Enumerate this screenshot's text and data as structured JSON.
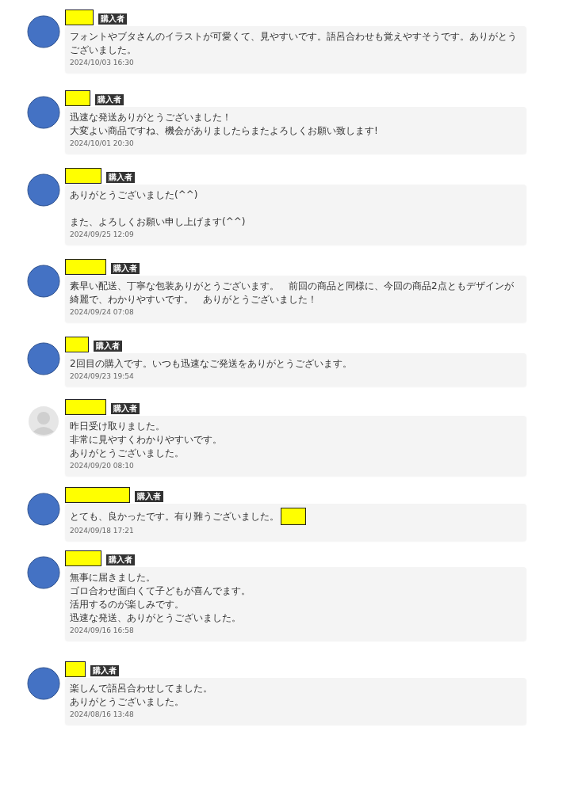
{
  "reviews": [
    {
      "avatar": {
        "kind": "circle"
      },
      "badge": "購入者",
      "paragraphs": [
        [
          "フォントやブタさんのイラストが可愛くて、見やすいです。語呂合わせも覚えやすそうです。ありがとうございました。"
        ]
      ],
      "date": "2024/10/03 16:30",
      "trailing_redaction": false
    },
    {
      "avatar": {
        "kind": "circle"
      },
      "badge": "購入者",
      "paragraphs": [
        [
          "迅速な発送ありがとうございました！",
          "大変よい商品ですね、機会がありましたらまたよろしくお願い致します!"
        ]
      ],
      "date": "2024/10/01 20:30",
      "trailing_redaction": false
    },
    {
      "avatar": {
        "kind": "circle"
      },
      "badge": "購入者",
      "paragraphs": [
        [
          "ありがとうございました(^^)"
        ],
        [
          "また、よろしくお願い申し上げます(^^)"
        ]
      ],
      "date": "2024/09/25 12:09",
      "trailing_redaction": false
    },
    {
      "avatar": {
        "kind": "circle"
      },
      "badge": "購入者",
      "paragraphs": [
        [
          "素早い配送、丁寧な包装ありがとうございます。　前回の商品と同様に、今回の商品2点ともデザインが綺麗で、わかりやすいです。　ありがとうございました！"
        ]
      ],
      "date": "2024/09/24 07:08",
      "trailing_redaction": false
    },
    {
      "avatar": {
        "kind": "circle"
      },
      "badge": "購入者",
      "paragraphs": [
        [
          "2回目の購入です。いつも迅速なご発送をありがとうございます。"
        ]
      ],
      "date": "2024/09/23 19:54",
      "trailing_redaction": false
    },
    {
      "avatar": {
        "kind": "default"
      },
      "badge": "購入者",
      "paragraphs": [
        [
          "昨日受け取りました。",
          "非常に見やすくわかりやすいです。",
          "ありがとうございました。"
        ]
      ],
      "date": "2024/09/20 08:10",
      "trailing_redaction": false
    },
    {
      "avatar": {
        "kind": "circle"
      },
      "badge": "購入者",
      "paragraphs": [
        [
          "とても、良かったです。有り難うございました。"
        ]
      ],
      "date": "2024/09/18 17:21",
      "trailing_redaction": true
    },
    {
      "avatar": {
        "kind": "circle"
      },
      "badge": "購入者",
      "paragraphs": [
        [
          "無事に届きました。",
          "ゴロ合わせ面白くて子どもが喜んでます。",
          "活用するのが楽しみです。",
          "迅速な発送、ありがとうございました。"
        ]
      ],
      "date": "2024/09/16 16:58",
      "trailing_redaction": false
    },
    {
      "avatar": {
        "kind": "circle"
      },
      "badge": "購入者",
      "paragraphs": [
        [
          "楽しんで語呂合わせしてました。",
          "ありがとうございました。"
        ]
      ],
      "date": "2024/08/16 13:48",
      "trailing_redaction": false
    }
  ]
}
